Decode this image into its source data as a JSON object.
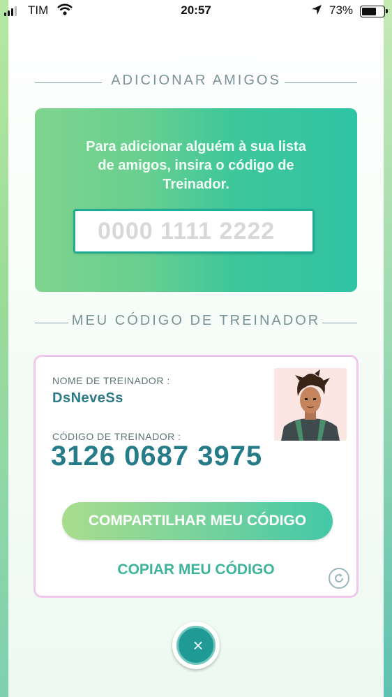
{
  "status_bar": {
    "carrier": "TIM",
    "time": "20:57",
    "battery_percent": "73%",
    "battery_level": 0.73,
    "icons": [
      "signal-icon",
      "wifi-icon",
      "location-arrow-icon",
      "battery-icon"
    ]
  },
  "add_friends": {
    "heading": "ADICIONAR AMIGOS",
    "instructions": "Para adicionar alguém à sua lista de amigos, insira o código de Treinador.",
    "input_placeholder": "0000 1111 2222",
    "input_value": ""
  },
  "my_code": {
    "heading": "MEU CÓDIGO DE TREINADOR",
    "name_label": "NOME DE TREINADOR :",
    "name_value": "DsNeveSs",
    "code_label": "CÓDIGO DE TREINADOR :",
    "code_value": "3126 0687 3975",
    "share_label": "COMPARTILHAR MEU CÓDIGO",
    "copy_label": "COPIAR MEU CÓDIGO",
    "refresh_icon": "refresh-icon",
    "avatar": "trainer-avatar"
  },
  "close": {
    "icon": "close-icon",
    "glyph": "×"
  },
  "colors": {
    "accent_teal": "#2fc3a4",
    "accent_green": "#7fd48e",
    "code_text": "#257c88",
    "card_border": "#efc8ec"
  }
}
